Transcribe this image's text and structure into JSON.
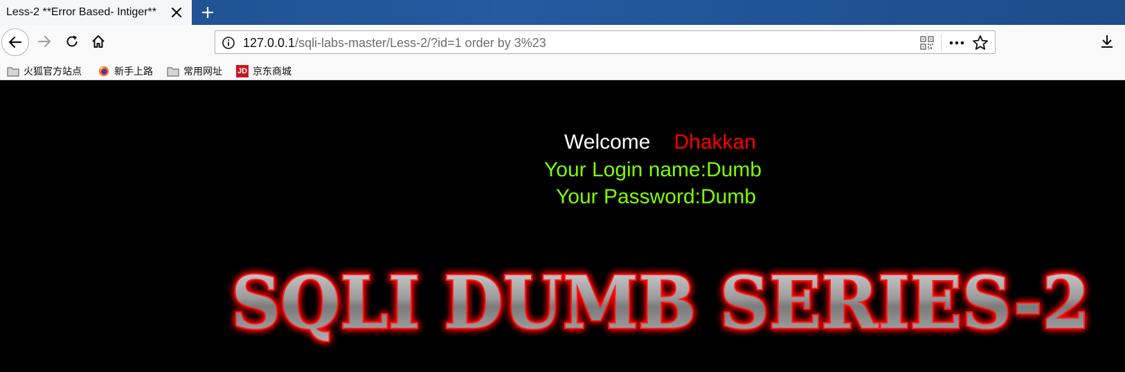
{
  "browser": {
    "tab": {
      "title": "Less-2 **Error Based- Intiger**"
    },
    "url": {
      "host": "127.0.0.1",
      "path": "/sqli-labs-master/Less-2/?id=1 order by 3%23"
    },
    "bookmarks": [
      {
        "label": "火狐官方站点",
        "icon": "folder-icon"
      },
      {
        "label": "新手上路",
        "icon": "firefox-icon"
      },
      {
        "label": "常用网址",
        "icon": "folder-icon"
      },
      {
        "label": "京东商城",
        "icon": "jd-icon"
      }
    ],
    "colors": {
      "tabstrip": "#235aa0",
      "toolbar": "#f9f9fa"
    }
  },
  "page": {
    "welcome": "Welcome",
    "user": "Dhakkan",
    "login": "Your Login name:Dumb",
    "password": "Your Password:Dumb",
    "banner": "SQLI DUMB SERIES-2",
    "colors": {
      "background": "#000000",
      "welcome": "#ffffff",
      "user": "#ff0000",
      "result": "#7fff00",
      "banner_glow": "#ff0000"
    }
  }
}
